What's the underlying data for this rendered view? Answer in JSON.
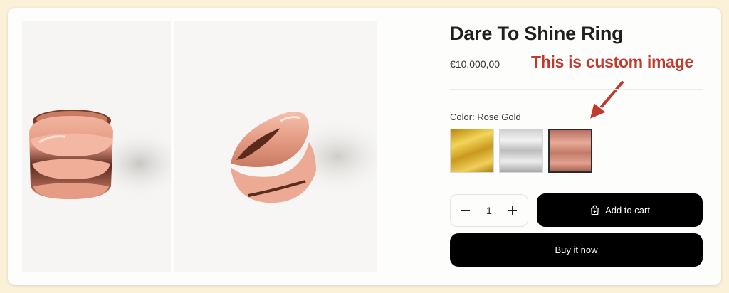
{
  "product": {
    "title": "Dare To Shine Ring",
    "price": "€10.000,00",
    "color_label": "Color: Rose Gold",
    "swatches": [
      {
        "name": "Gold",
        "color": "#d9b43a",
        "selected": false
      },
      {
        "name": "Silver",
        "color": "#d0d0d0",
        "selected": false
      },
      {
        "name": "Rose Gold",
        "color": "#cf8c7b",
        "selected": true
      }
    ]
  },
  "annotation": {
    "text": "This is custom image",
    "color": "#c0392b"
  },
  "quantity": {
    "value": "1"
  },
  "actions": {
    "add_to_cart": "Add to cart",
    "buy_now": "Buy it now"
  },
  "media": [
    {
      "icon": "rose-gold-ring-front"
    },
    {
      "icon": "rose-gold-ring-side"
    }
  ]
}
